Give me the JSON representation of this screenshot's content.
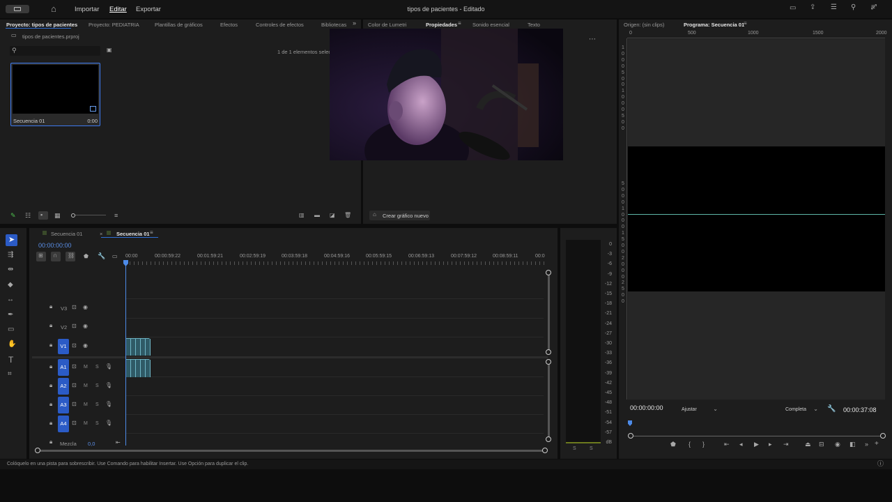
{
  "topbar": {
    "nav": [
      "Importar",
      "Editar",
      "Exportar"
    ],
    "active_nav": "Editar",
    "title": "tipos de pacientes - Editado"
  },
  "upper_tabs": {
    "left": [
      "Proyecto: tipos de pacientes",
      "Proyecto: PEDIATRIA",
      "Plantillas de gráficos",
      "Efectos",
      "Controles de efectos",
      "Bibliotecas"
    ],
    "center": [
      "Color de Lumetri",
      "Propiedades",
      "Sonido esencial",
      "Texto"
    ],
    "right": [
      "Origen: (sin clips)",
      "Programa: Secuencia 01"
    ]
  },
  "project": {
    "file": "tipos de pacientes.prproj",
    "count": "1 de 1 elementos selec",
    "item_name": "Secuencia 01",
    "item_duration": "0:00"
  },
  "properties": {
    "create_graphic": "Crear gráfico nuevo"
  },
  "timeline": {
    "tabs": [
      "Secuencia 01",
      "Secuencia 01"
    ],
    "timecode": "00:00:00:00",
    "ruler": [
      "00:00",
      "00:00:59:22",
      "00:01:59:21",
      "00:02:59:19",
      "00:03:59:18",
      "00:04:59:16",
      "00:05:59:15",
      "00:06:59:13",
      "00:07:59:12",
      "00:08:59:11",
      "00:0"
    ],
    "video_tracks": [
      "V3",
      "V2",
      "V1"
    ],
    "audio_tracks": [
      "A1",
      "A2",
      "A3",
      "A4"
    ],
    "mix_label": "Mezcla",
    "mix_value": "0,0",
    "ms": [
      "M",
      "S"
    ]
  },
  "meter": {
    "db_labels": [
      "0",
      "-3",
      "-6",
      "-9",
      "-12",
      "-15",
      "-18",
      "-21",
      "-24",
      "-27",
      "-30",
      "-33",
      "-36",
      "-39",
      "-42",
      "-45",
      "-48",
      "-51",
      "-54",
      "-57",
      "dB"
    ],
    "bottom": [
      "S",
      "S"
    ]
  },
  "program": {
    "ruler_top": [
      "0",
      "500",
      "1000",
      "1500",
      "2000"
    ],
    "ruler_left": [
      "1",
      "0",
      "0",
      "0",
      "5",
      "0",
      "0",
      "1",
      "0",
      "0",
      "0",
      "5",
      "0",
      "0"
    ],
    "ruler_left2": [
      "5",
      "0",
      "0",
      "0",
      "1",
      "0",
      "0",
      "0",
      "1",
      "5",
      "0",
      "0",
      "2",
      "0",
      "0",
      "0",
      "2",
      "5",
      "0",
      "0"
    ],
    "timecode_left": "00:00:00:00",
    "fit": "Ajustar",
    "quality": "Completa",
    "timecode_right": "00:00:37:08"
  },
  "statusbar": {
    "text": "Colóquelo en una pista para sobrescribir. Use Comando para habilitar Insertar. Use Opción para duplicar el clip."
  },
  "colors": {
    "accent": "#2b5bc6",
    "playhead": "#4d8be8"
  }
}
